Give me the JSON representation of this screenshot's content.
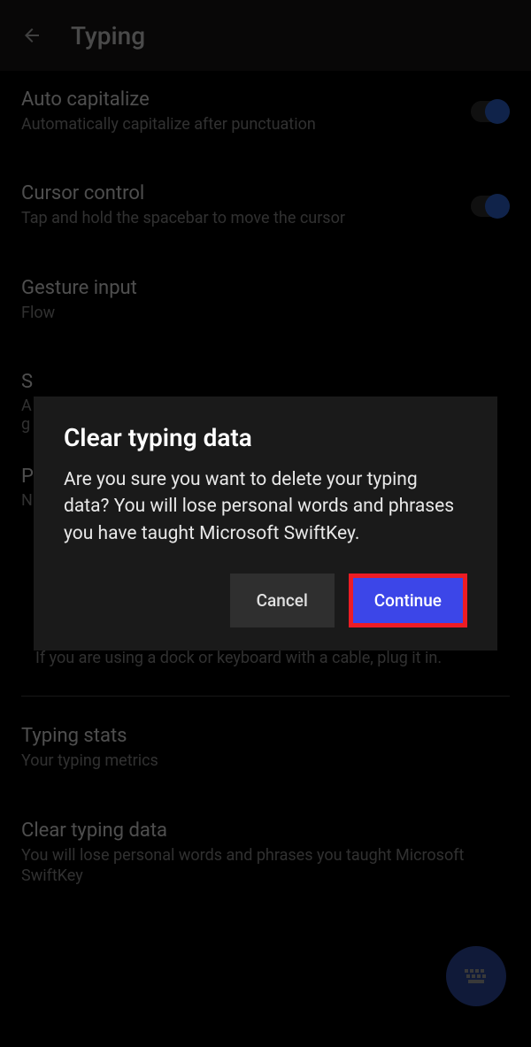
{
  "header": {
    "title": "Typing"
  },
  "settings": {
    "auto_cap": {
      "title": "Auto capitalize",
      "subtitle": "Automatically capitalize after punctuation"
    },
    "cursor": {
      "title": "Cursor control",
      "subtitle": "Tap and hold the spacebar to move the cursor"
    },
    "gesture": {
      "title": "Gesture input",
      "subtitle": "Flow"
    },
    "partial1": {
      "title": "S",
      "sub1": "A",
      "sub2": "g"
    },
    "partial2": {
      "title": "P",
      "sub": "N"
    },
    "dock": {
      "subtitle": "If you are using a dock or keyboard with a cable, plug it in."
    },
    "stats": {
      "title": "Typing stats",
      "subtitle": "Your typing metrics"
    },
    "clear": {
      "title": "Clear typing data",
      "subtitle": "You will lose personal words and phrases you taught Microsoft SwiftKey"
    }
  },
  "dialog": {
    "title": "Clear typing data",
    "body": "Are you sure you want to delete your typing data? You will lose personal words and phrases you have taught Microsoft SwiftKey.",
    "cancel": "Cancel",
    "continue": "Continue"
  }
}
